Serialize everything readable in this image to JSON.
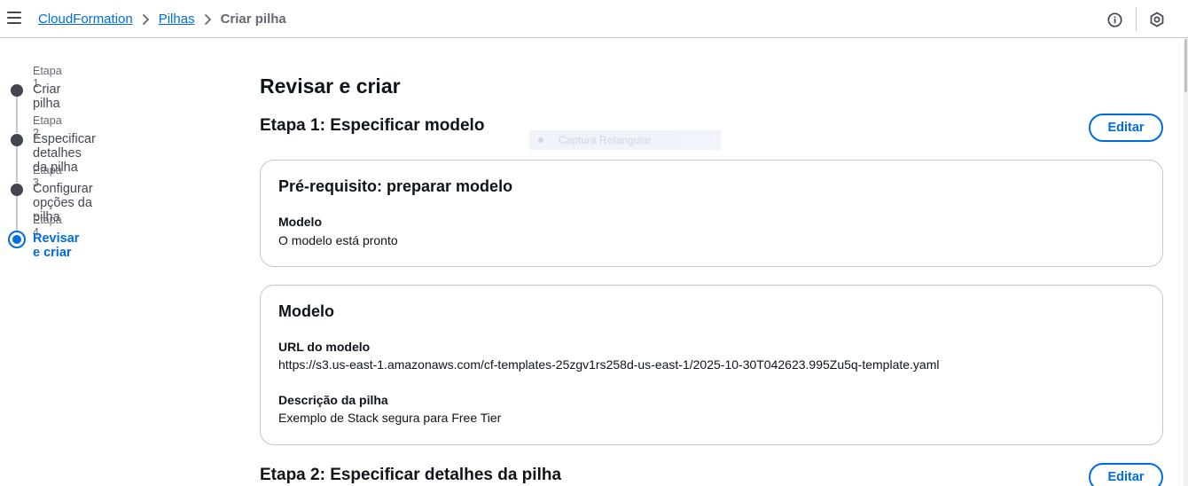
{
  "header": {
    "breadcrumbs": [
      {
        "label": "CloudFormation"
      },
      {
        "label": "Pilhas"
      }
    ],
    "current": "Criar pilha"
  },
  "steps": [
    {
      "number": "Etapa 1",
      "title": "Criar pilha"
    },
    {
      "number": "Etapa 2",
      "title": "Especificar detalhes da pilha"
    },
    {
      "number": "Etapa 3",
      "title": "Configurar opções da pilha"
    },
    {
      "number": "Etapa 4",
      "title": "Revisar e criar"
    }
  ],
  "main": {
    "title": "Revisar e criar",
    "overlay_text": "Captura Retangular",
    "section1": {
      "title": "Etapa 1: Especificar modelo",
      "edit_label": "Editar",
      "prereq_card": {
        "title": "Pré-requisito: preparar modelo",
        "label": "Modelo",
        "value": "O modelo está pronto"
      },
      "model_card": {
        "title": "Modelo",
        "url_label": "URL do modelo",
        "url_value": "https://s3.us-east-1.amazonaws.com/cf-templates-25zgv1rs258d-us-east-1/2025-10-30T042623.995Zu5q-template.yaml",
        "desc_label": "Descrição da pilha",
        "desc_value": "Exemplo de Stack segura para Free Tier"
      }
    },
    "section2": {
      "title": "Etapa 2: Especificar detalhes da pilha",
      "edit_label": "Editar"
    }
  }
}
